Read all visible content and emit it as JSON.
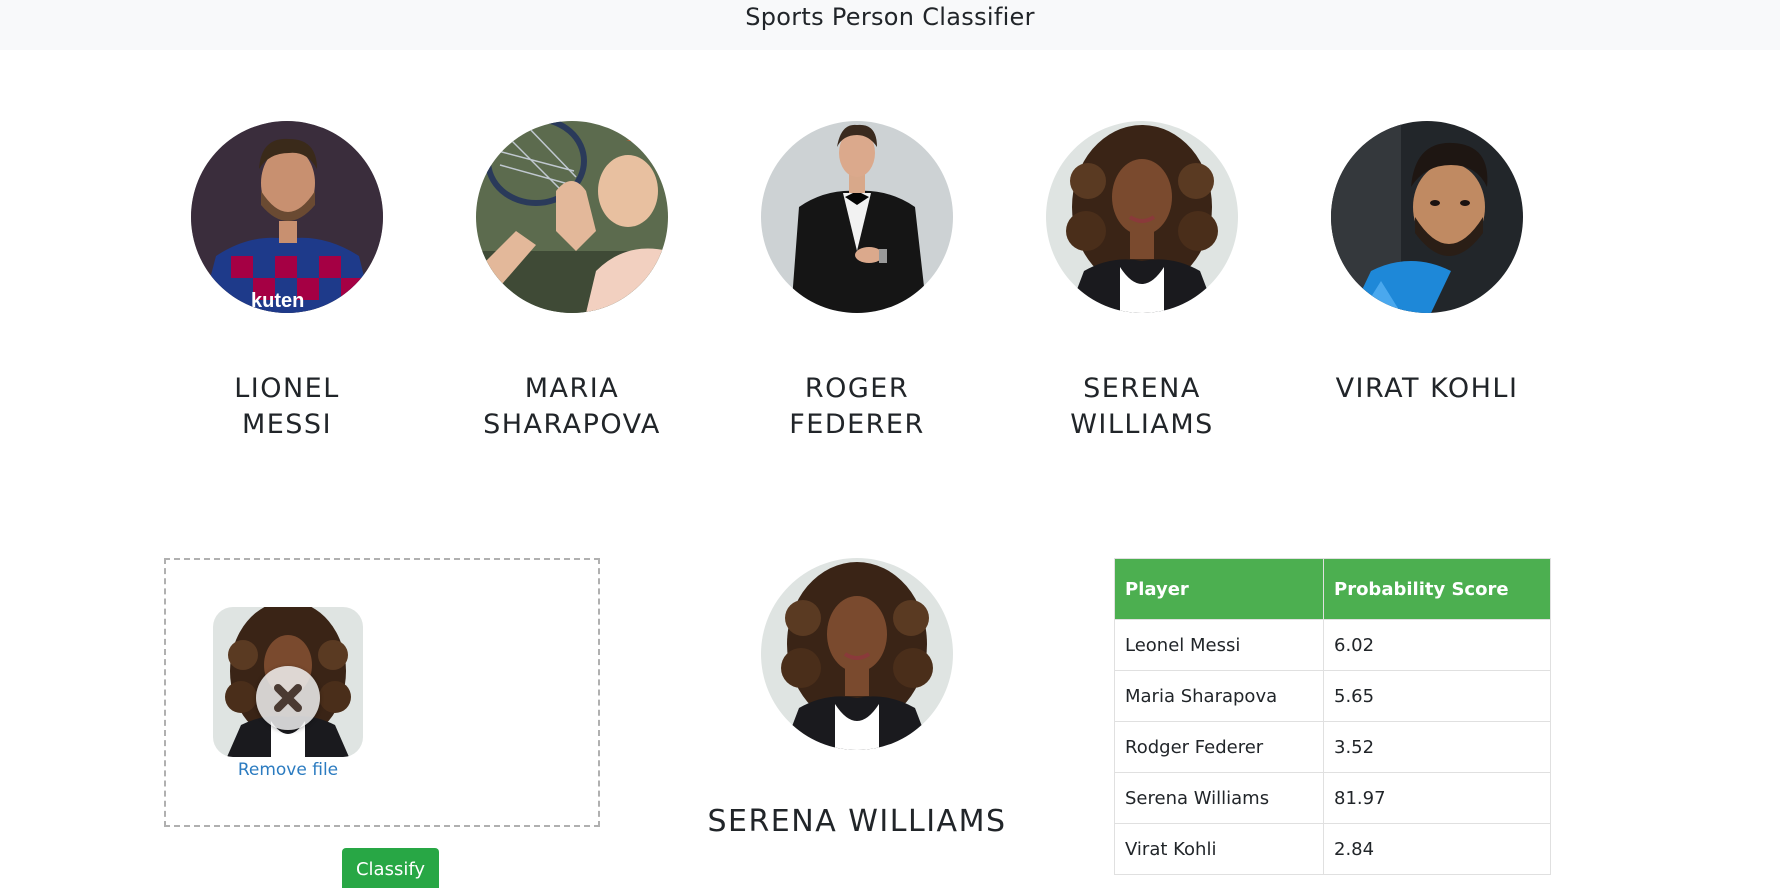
{
  "navbar": {
    "title": "Sports Person Classifier"
  },
  "players": [
    {
      "name_line1": "LIONEL",
      "name_line2": "MESSI"
    },
    {
      "name_line1": "MARIA",
      "name_line2": "SHARAPOVA"
    },
    {
      "name_line1": "ROGER",
      "name_line2": "FEDERER"
    },
    {
      "name_line1": "SERENA",
      "name_line2": "WILLIAMS"
    },
    {
      "name_line1": "VIRAT KOHLI",
      "name_line2": ""
    }
  ],
  "upload": {
    "remove_label": "Remove file"
  },
  "classify_label": "Classify",
  "result": {
    "name": "SERENA WILLIAMS"
  },
  "table": {
    "headers": [
      "Player",
      "Probability Score"
    ],
    "rows": [
      [
        "Leonel Messi",
        "6.02"
      ],
      [
        "Maria Sharapova",
        "5.65"
      ],
      [
        "Rodger Federer",
        "3.52"
      ],
      [
        "Serena Williams",
        "81.97"
      ],
      [
        "Virat Kohli",
        "2.84"
      ]
    ]
  },
  "colors": {
    "header_green": "#4caf50",
    "button_green": "#28a745",
    "link_blue": "#2b7bc0",
    "navbar_bg": "#f8f9fa"
  }
}
